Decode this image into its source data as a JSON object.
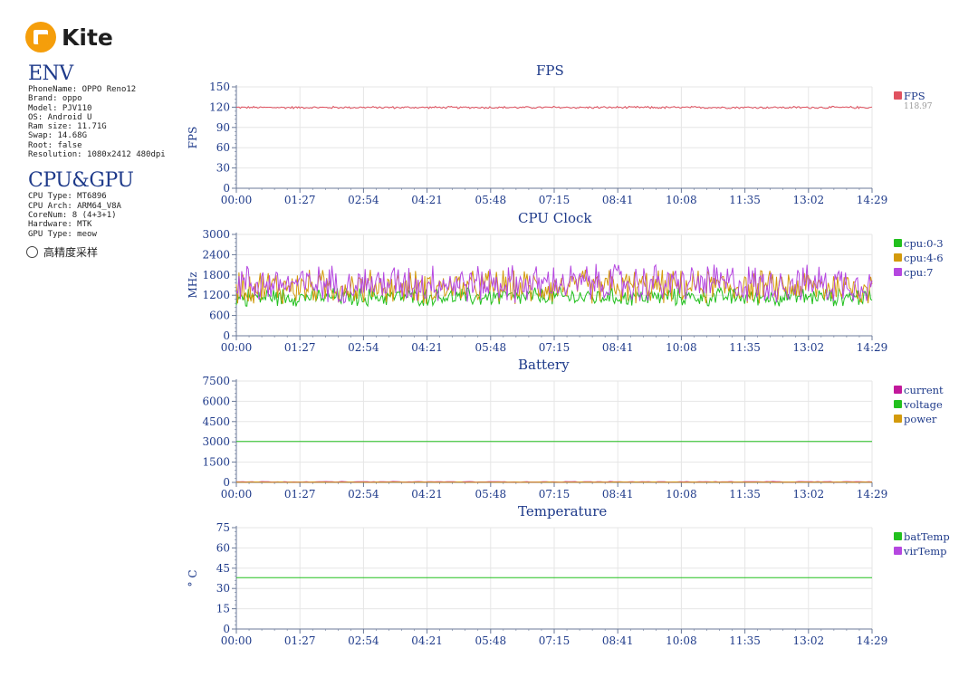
{
  "brand": {
    "name": "Kite",
    "color": "#f59e0b"
  },
  "env": {
    "title": "ENV",
    "lines": [
      "PhoneName: OPPO Reno12",
      "Brand: oppo",
      "Model: PJV110",
      "OS: Android U",
      "Ram size: 11.71G",
      "Swap: 14.68G",
      "Root: false",
      "Resolution: 1080x2412 480dpi"
    ]
  },
  "cpugpu": {
    "title": "CPU&GPU",
    "lines": [
      "CPU Type: MT6896",
      "CPU Arch: ARM64_V8A",
      "CoreNum: 8 (4+3+1)",
      "Hardware: MTK",
      "GPU Type: meow"
    ]
  },
  "high_precision_label": "高精度采样",
  "time_ticks": [
    "00:00",
    "01:27",
    "02:54",
    "04:21",
    "05:48",
    "07:15",
    "08:41",
    "10:08",
    "11:35",
    "13:02",
    "14:29"
  ],
  "chart_data": [
    {
      "type": "line",
      "title": "FPS",
      "ylabel": "FPS",
      "ylim": [
        0,
        150
      ],
      "yticks": [
        0,
        30,
        60,
        90,
        120,
        150
      ],
      "grid": true,
      "legend_position": "right",
      "series": [
        {
          "name": "FPS",
          "color": "#e05260",
          "value_label": "118.97",
          "mean": 119.5,
          "noise": 1.8,
          "points": 480
        }
      ]
    },
    {
      "type": "line",
      "title": "CPU Clock",
      "ylabel": "MHz",
      "ylim": [
        0,
        3000
      ],
      "yticks": [
        0,
        600,
        1200,
        1800,
        2400,
        3000
      ],
      "grid": true,
      "legend_position": "right",
      "series": [
        {
          "name": "cpu:0-3",
          "color": "#22c01e",
          "mean": 1150,
          "noise": 280,
          "points": 480
        },
        {
          "name": "cpu:4-6",
          "color": "#d39a0c",
          "mean": 1450,
          "noise": 520,
          "points": 480
        },
        {
          "name": "cpu:7",
          "color": "#b547e0",
          "mean": 1550,
          "noise": 580,
          "points": 480
        }
      ]
    },
    {
      "type": "line",
      "title": "Battery",
      "ylabel": "",
      "ylim": [
        0,
        7500
      ],
      "yticks": [
        0,
        1500,
        3000,
        4500,
        6000,
        7500
      ],
      "grid": true,
      "legend_position": "right",
      "series": [
        {
          "name": "current",
          "color": "#c2189b",
          "mean": 40,
          "noise": 25,
          "points": 200
        },
        {
          "name": "voltage",
          "color": "#22c01e",
          "mean": 3030,
          "noise": 0,
          "points": 2
        },
        {
          "name": "power",
          "color": "#d39a0c",
          "mean": 20,
          "noise": 15,
          "points": 200
        }
      ]
    },
    {
      "type": "line",
      "title": "Temperature",
      "ylabel": "° C",
      "ylim": [
        0,
        75
      ],
      "yticks": [
        0,
        15,
        30,
        45,
        60,
        75
      ],
      "grid": true,
      "legend_position": "right",
      "series": [
        {
          "name": "batTemp",
          "color": "#22c01e",
          "mean": 38,
          "noise": 0,
          "points": 2
        },
        {
          "name": "virTemp",
          "color": "#b547e0",
          "mean": 38,
          "noise": 0,
          "points": 0
        }
      ]
    }
  ]
}
